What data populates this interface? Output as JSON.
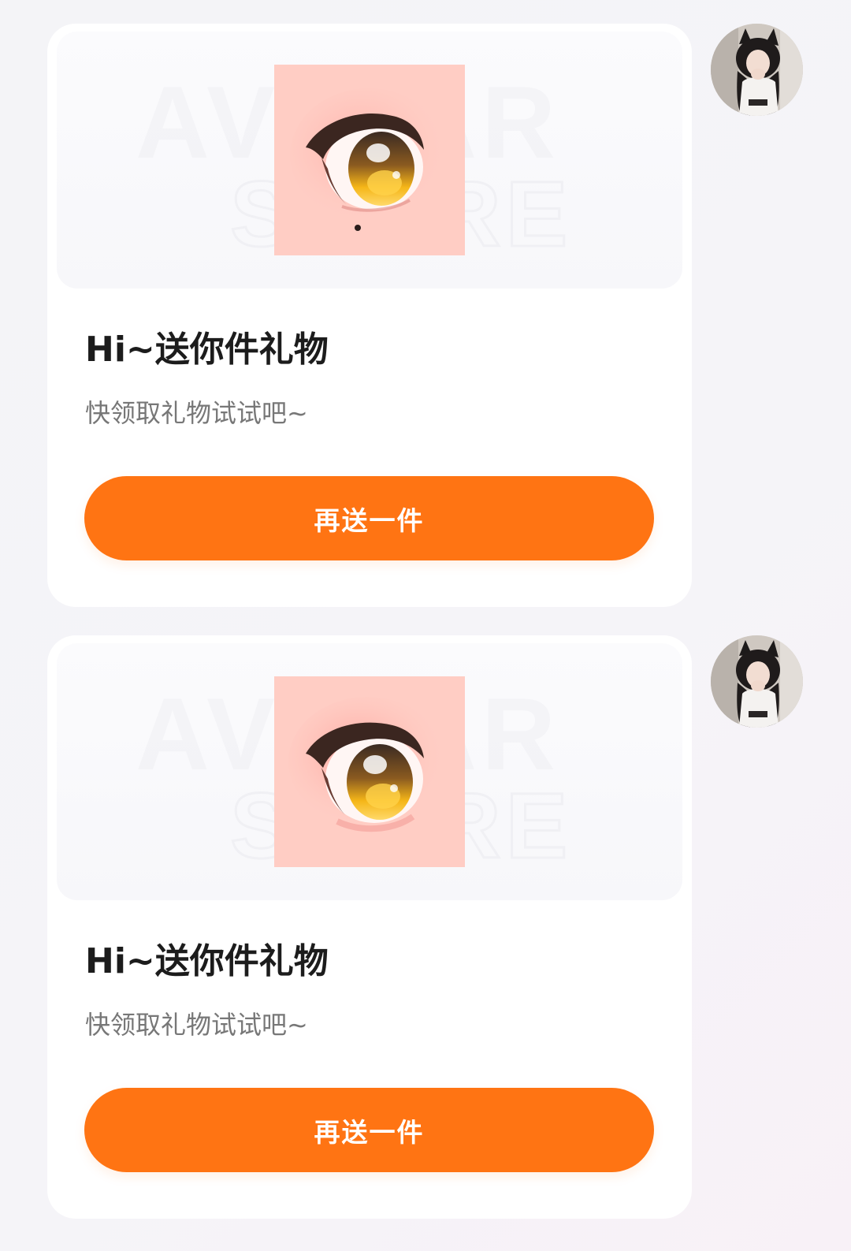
{
  "messages": [
    {
      "title": "Hi~送你件礼物",
      "subtitle": "快领取礼物试试吧~",
      "button_label": "再送一件",
      "watermark_text": [
        "AVATAR",
        "STORE"
      ],
      "gift_icon": "anime-eye-icon",
      "sender_avatar": "avatar"
    },
    {
      "title": "Hi~送你件礼物",
      "subtitle": "快领取礼物试试吧~",
      "button_label": "再送一件",
      "watermark_text": [
        "AVATAR",
        "STORE"
      ],
      "gift_icon": "anime-eye-icon",
      "sender_avatar": "avatar"
    }
  ],
  "colors": {
    "accent": "#ff7413",
    "title": "#1c1c1c",
    "subtitle": "#777777",
    "gift_background": "#ffcdc4",
    "iris": "#f2b319"
  }
}
